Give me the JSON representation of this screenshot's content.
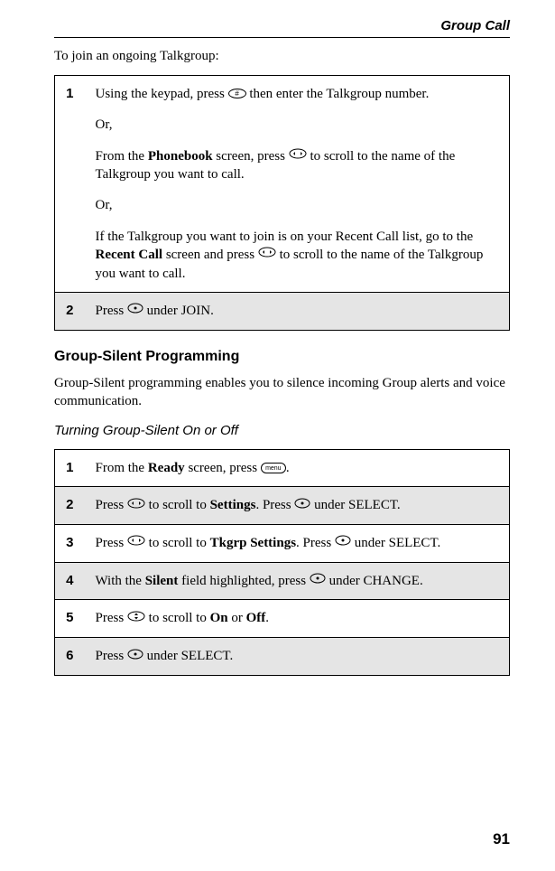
{
  "header": {
    "title": "Group Call"
  },
  "intro": "To join an ongoing Talkgroup:",
  "table1": {
    "steps": [
      {
        "num": "1",
        "segments": [
          {
            "t": "Using the keypad, press "
          },
          {
            "icon": "hash-key"
          },
          {
            "t": " then enter the Talkgroup number."
          },
          {
            "br2": true
          },
          {
            "t": "Or,"
          },
          {
            "br2": true
          },
          {
            "t": "From the "
          },
          {
            "bold": "Phonebook"
          },
          {
            "t": " screen, press "
          },
          {
            "icon": "nav-left-right"
          },
          {
            "t": " to scroll to the name of the Talkgroup you want to call."
          },
          {
            "br2": true
          },
          {
            "t": "Or,"
          },
          {
            "br2": true
          },
          {
            "t": "If the Talkgroup you want to join is on your Recent Call list, go to the "
          },
          {
            "bold": "Recent Call"
          },
          {
            "t": " screen and press "
          },
          {
            "icon": "nav-left-right"
          },
          {
            "t": " to scroll to the name of the Talkgroup you want to call."
          }
        ],
        "shaded": false
      },
      {
        "num": "2",
        "segments": [
          {
            "t": "Press "
          },
          {
            "icon": "soft-key"
          },
          {
            "t": " under JOIN."
          }
        ],
        "shaded": true
      }
    ]
  },
  "section2": {
    "heading": "Group-Silent Programming",
    "desc": "Group-Silent programming enables you to silence incoming Group alerts and voice communication.",
    "subheading": "Turning Group-Silent On or Off"
  },
  "table2": {
    "steps": [
      {
        "num": "1",
        "segments": [
          {
            "t": "From the "
          },
          {
            "bold": "Ready"
          },
          {
            "t": " screen, press "
          },
          {
            "icon": "menu-key"
          },
          {
            "t": "."
          }
        ],
        "shaded": false
      },
      {
        "num": "2",
        "segments": [
          {
            "t": "Press "
          },
          {
            "icon": "nav-left-right"
          },
          {
            "t": " to scroll to "
          },
          {
            "bold": "Settings"
          },
          {
            "t": ". Press "
          },
          {
            "icon": "soft-key"
          },
          {
            "t": " under SELECT."
          }
        ],
        "shaded": true
      },
      {
        "num": "3",
        "segments": [
          {
            "t": "Press "
          },
          {
            "icon": "nav-left-right"
          },
          {
            "t": " to scroll to "
          },
          {
            "bold": "Tkgrp Settings"
          },
          {
            "t": ". Press "
          },
          {
            "icon": "soft-key"
          },
          {
            "t": " under SELECT."
          }
        ],
        "shaded": false
      },
      {
        "num": "4",
        "segments": [
          {
            "t": "With the "
          },
          {
            "bold": "Silent"
          },
          {
            "t": " field highlighted, press "
          },
          {
            "icon": "soft-key"
          },
          {
            "t": " under CHANGE."
          }
        ],
        "shaded": true
      },
      {
        "num": "5",
        "segments": [
          {
            "t": "Press "
          },
          {
            "icon": "nav-up-down"
          },
          {
            "t": " to scroll to "
          },
          {
            "bold": "On"
          },
          {
            "t": " or "
          },
          {
            "bold": "Off"
          },
          {
            "t": "."
          }
        ],
        "shaded": false
      },
      {
        "num": "6",
        "segments": [
          {
            "t": "Press "
          },
          {
            "icon": "soft-key"
          },
          {
            "t": " under SELECT."
          }
        ],
        "shaded": true
      }
    ]
  },
  "pageNumber": "91"
}
